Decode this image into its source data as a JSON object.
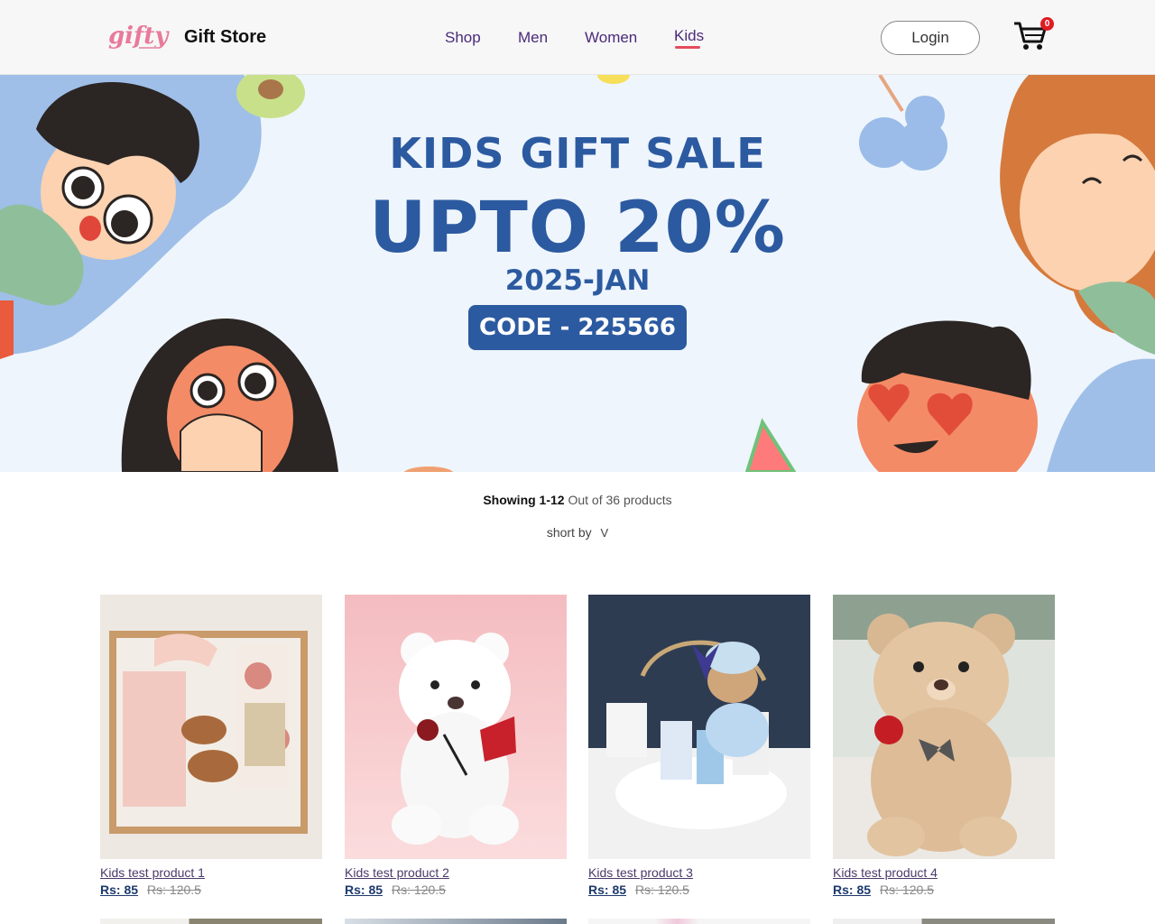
{
  "header": {
    "brand": "Gift Store",
    "logo_text": "gifty",
    "nav": [
      {
        "label": "Shop"
      },
      {
        "label": "Men"
      },
      {
        "label": "Women"
      },
      {
        "label": "Kids",
        "active": true
      }
    ],
    "login_label": "Login",
    "cart_count": "0",
    "accent_color": "#e54b5b"
  },
  "banner": {
    "line1": "KIDS GIFT SALE",
    "line2": "UPTO 20%",
    "line3": "2025-JAN",
    "code": "CODE - 225566",
    "text_color": "#2c5aa0"
  },
  "listing": {
    "showing_bold": "Showing 1-12",
    "showing_rest": " Out of 36 products",
    "sort_label": "short by",
    "sort_icon": "V"
  },
  "products": [
    {
      "name": "Kids test product 1",
      "price": "Rs: 85",
      "old_price": "Rs: 120.5"
    },
    {
      "name": "Kids test product 2",
      "price": "Rs: 85",
      "old_price": "Rs: 120.5"
    },
    {
      "name": "Kids test product 3",
      "price": "Rs: 85",
      "old_price": "Rs: 120.5"
    },
    {
      "name": "Kids test product 4",
      "price": "Rs: 85",
      "old_price": "Rs: 120.5"
    }
  ]
}
